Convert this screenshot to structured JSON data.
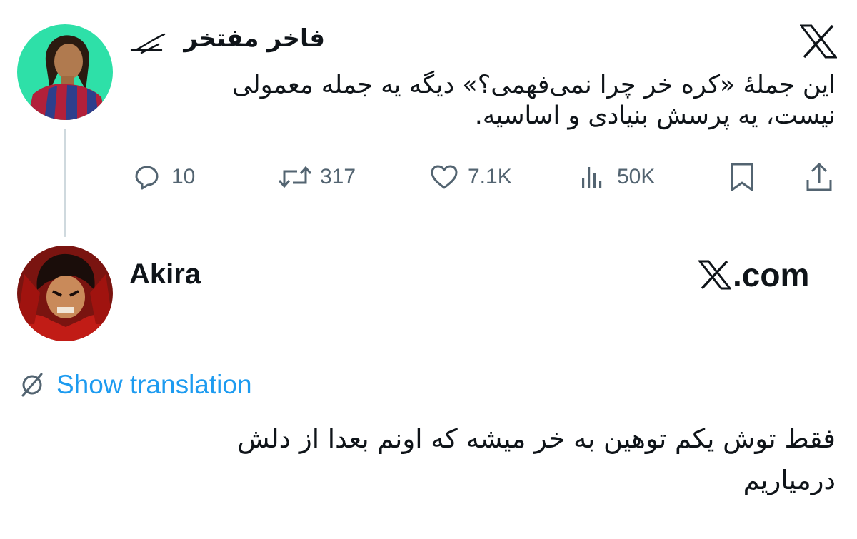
{
  "tweet": {
    "author_name": "فاخر مفتخر",
    "platform_icon": "x-logo-icon",
    "lines": [
      "این جملهٔ «کره خر چرا نمی‌فهمی؟» دیگه یه جمله معمولی",
      "نیست، یه پرسش بنیادی و اساسیه."
    ],
    "actions": {
      "replies": "10",
      "reposts": "317",
      "likes": "7.1K",
      "views": "50K"
    }
  },
  "reply": {
    "author_name": "Akira",
    "watermark": ".com",
    "show_translation": "Show translation",
    "lines": [
      "فقط توش یکم توهین به خر میشه که اونم بعدا از دلش",
      "درمیاریم"
    ]
  },
  "colors": {
    "text": "#0f1419",
    "secondary": "#536471",
    "link": "#1d9bf0",
    "thread_line": "#cfd9de"
  }
}
